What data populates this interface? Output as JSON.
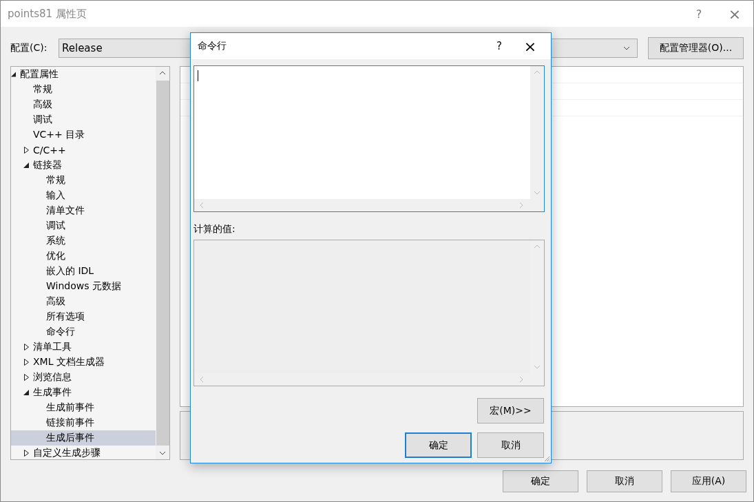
{
  "window": {
    "title": "points81 属性页",
    "help": "?",
    "close": "×"
  },
  "config": {
    "label": "配置(C):",
    "value": "Release",
    "manager_button": "配置管理器(O)..."
  },
  "tree": [
    {
      "label": "配置属性",
      "expanded": true,
      "selected": false,
      "children": [
        {
          "label": "常规",
          "selected": false
        },
        {
          "label": "高级",
          "selected": false
        },
        {
          "label": "调试",
          "selected": false
        },
        {
          "label": "VC++ 目录",
          "selected": false
        },
        {
          "label": "C/C++",
          "expanded": false,
          "selected": false
        },
        {
          "label": "链接器",
          "expanded": true,
          "selected": false,
          "children": [
            {
              "label": "常规",
              "selected": false
            },
            {
              "label": "输入",
              "selected": false
            },
            {
              "label": "清单文件",
              "selected": false
            },
            {
              "label": "调试",
              "selected": false
            },
            {
              "label": "系统",
              "selected": false
            },
            {
              "label": "优化",
              "selected": false
            },
            {
              "label": "嵌入的 IDL",
              "selected": false
            },
            {
              "label": "Windows 元数据",
              "selected": false
            },
            {
              "label": "高级",
              "selected": false
            },
            {
              "label": "所有选项",
              "selected": false
            },
            {
              "label": "命令行",
              "selected": false
            }
          ]
        },
        {
          "label": "清单工具",
          "expanded": false,
          "selected": false
        },
        {
          "label": "XML 文档生成器",
          "expanded": false,
          "selected": false
        },
        {
          "label": "浏览信息",
          "expanded": false,
          "selected": false
        },
        {
          "label": "生成事件",
          "expanded": true,
          "selected": false,
          "children": [
            {
              "label": "生成前事件",
              "selected": false
            },
            {
              "label": "链接前事件",
              "selected": false
            },
            {
              "label": "生成后事件",
              "selected": true
            }
          ]
        },
        {
          "label": "自定义生成步骤",
          "expanded": false,
          "selected": false
        }
      ]
    }
  ],
  "buttons": [
    "确定",
    "取消",
    "应用(A)"
  ],
  "dialog": {
    "title": "命令行",
    "help": "?",
    "close": "×",
    "evaluated_label": "计算的值:",
    "macro_button": "宏(M)>>",
    "buttons": [
      {
        "label": "确定",
        "default": true
      },
      {
        "label": "取消",
        "default": false
      }
    ]
  }
}
